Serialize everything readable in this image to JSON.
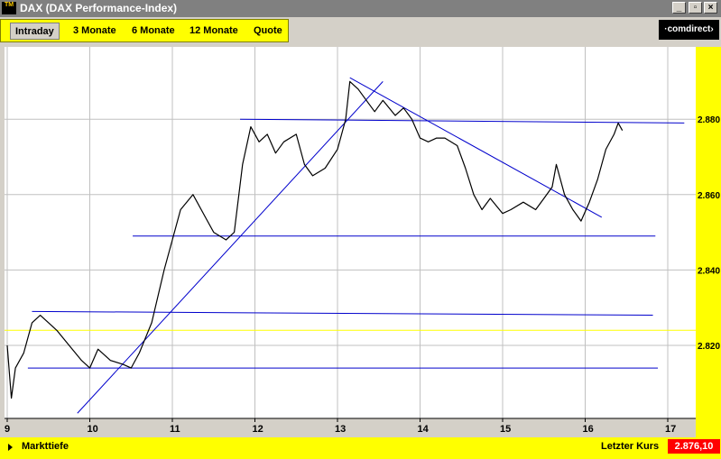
{
  "window": {
    "title": "DAX (DAX Performance-Index)",
    "icon_label": "TM",
    "buttons": {
      "minimize": "_",
      "restore": "▫",
      "close": "×"
    }
  },
  "tabs": [
    {
      "label": "Intraday",
      "active": true
    },
    {
      "label": "3 Monate",
      "active": false
    },
    {
      "label": "6 Monate",
      "active": false
    },
    {
      "label": "12 Monate",
      "active": false
    },
    {
      "label": "Quote",
      "active": false
    }
  ],
  "brand": {
    "logo_text": "·comdirect›"
  },
  "status": {
    "market_depth_label": "Markttiefe",
    "last_price_label": "Letzter Kurs",
    "last_price_value": "2.876,10"
  },
  "colors": {
    "accent": "#ffff00",
    "price_box": "#ff0000",
    "trend_lines": "#0000cc",
    "price_line": "#000000",
    "chart_bg": "#ffffff",
    "grid": "#c0c0c0"
  },
  "chart_data": {
    "type": "line",
    "x_ticks": [
      "9",
      "10",
      "11",
      "12",
      "13",
      "14",
      "15",
      "16",
      "17"
    ],
    "y_ticks": [
      "2.820",
      "2.840",
      "2.860",
      "2.880"
    ],
    "xlim": [
      9,
      17
    ],
    "ylim": [
      2802,
      2892
    ],
    "grid": true,
    "y_axis_side": "right",
    "series": [
      {
        "points": [
          [
            9.0,
            2820
          ],
          [
            9.05,
            2806
          ],
          [
            9.1,
            2814
          ],
          [
            9.2,
            2818
          ],
          [
            9.3,
            2826
          ],
          [
            9.4,
            2828
          ],
          [
            9.5,
            2826
          ],
          [
            9.6,
            2824
          ],
          [
            9.75,
            2820
          ],
          [
            9.9,
            2816
          ],
          [
            10.0,
            2814
          ],
          [
            10.1,
            2819
          ],
          [
            10.25,
            2816
          ],
          [
            10.4,
            2815
          ],
          [
            10.5,
            2814
          ],
          [
            10.6,
            2818
          ],
          [
            10.75,
            2826
          ],
          [
            10.9,
            2840
          ],
          [
            11.0,
            2848
          ],
          [
            11.1,
            2856
          ],
          [
            11.25,
            2860
          ],
          [
            11.4,
            2854
          ],
          [
            11.5,
            2850
          ],
          [
            11.65,
            2848
          ],
          [
            11.75,
            2850
          ],
          [
            11.85,
            2868
          ],
          [
            11.95,
            2878
          ],
          [
            12.05,
            2874
          ],
          [
            12.15,
            2876
          ],
          [
            12.25,
            2871
          ],
          [
            12.35,
            2874
          ],
          [
            12.5,
            2876
          ],
          [
            12.6,
            2868
          ],
          [
            12.7,
            2865
          ],
          [
            12.85,
            2867
          ],
          [
            13.0,
            2872
          ],
          [
            13.1,
            2880
          ],
          [
            13.15,
            2890
          ],
          [
            13.25,
            2888
          ],
          [
            13.35,
            2885
          ],
          [
            13.45,
            2882
          ],
          [
            13.55,
            2885
          ],
          [
            13.7,
            2881
          ],
          [
            13.8,
            2883
          ],
          [
            13.9,
            2880
          ],
          [
            14.0,
            2875
          ],
          [
            14.1,
            2874
          ],
          [
            14.2,
            2875
          ],
          [
            14.3,
            2875
          ],
          [
            14.45,
            2873
          ],
          [
            14.55,
            2867
          ],
          [
            14.65,
            2860
          ],
          [
            14.75,
            2856
          ],
          [
            14.85,
            2859
          ],
          [
            15.0,
            2855
          ],
          [
            15.1,
            2856
          ],
          [
            15.25,
            2858
          ],
          [
            15.4,
            2856
          ],
          [
            15.5,
            2859
          ],
          [
            15.6,
            2862
          ],
          [
            15.65,
            2868
          ],
          [
            15.75,
            2860
          ],
          [
            15.85,
            2856
          ],
          [
            15.95,
            2853
          ],
          [
            16.05,
            2858
          ],
          [
            16.15,
            2864
          ],
          [
            16.2,
            2868
          ],
          [
            16.25,
            2872
          ],
          [
            16.35,
            2876
          ],
          [
            16.4,
            2879
          ],
          [
            16.45,
            2877
          ]
        ]
      }
    ],
    "trend_lines": [
      {
        "from": [
          9.85,
          2802
        ],
        "to": [
          13.55,
          2890
        ]
      },
      {
        "from": [
          13.15,
          2891
        ],
        "to": [
          16.2,
          2854
        ]
      },
      {
        "from": [
          11.82,
          2880
        ],
        "to": [
          17.2,
          2879
        ]
      },
      {
        "from": [
          10.52,
          2849
        ],
        "to": [
          16.85,
          2849
        ]
      },
      {
        "from": [
          9.3,
          2829
        ],
        "to": [
          16.82,
          2828
        ]
      },
      {
        "from": [
          9.25,
          2814
        ],
        "to": [
          16.88,
          2814
        ]
      }
    ],
    "reference_line": {
      "value": 2824,
      "color": "#ffff00"
    }
  }
}
